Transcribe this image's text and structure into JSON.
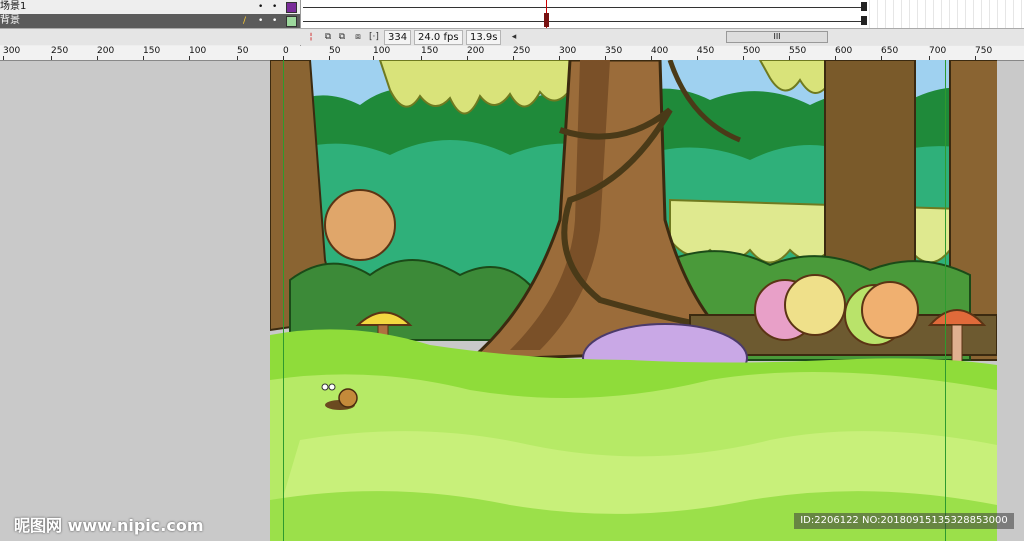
{
  "timeline": {
    "layers": [
      {
        "name": "场景1",
        "color": "#7a2c9a"
      },
      {
        "name": "背景",
        "color": "#9dd89d"
      }
    ],
    "toolbar": {
      "frame_number": "334",
      "fps": "24.0 fps",
      "time": "13.9s",
      "scroll_label": "III"
    },
    "ruler_labels": [
      "300",
      "250",
      "200",
      "150",
      "100",
      "50",
      "0",
      "50",
      "100",
      "150",
      "200",
      "250",
      "300",
      "350",
      "400",
      "450",
      "500",
      "550",
      "600",
      "650",
      "700",
      "750"
    ]
  },
  "stage": {
    "description_icons": [
      "snail-icon",
      "mushroom-icon"
    ]
  },
  "watermark": {
    "text": "昵图网 www.nipic.com"
  },
  "id_badge": {
    "text": "ID:2206122 NO:20180915135328853000"
  }
}
